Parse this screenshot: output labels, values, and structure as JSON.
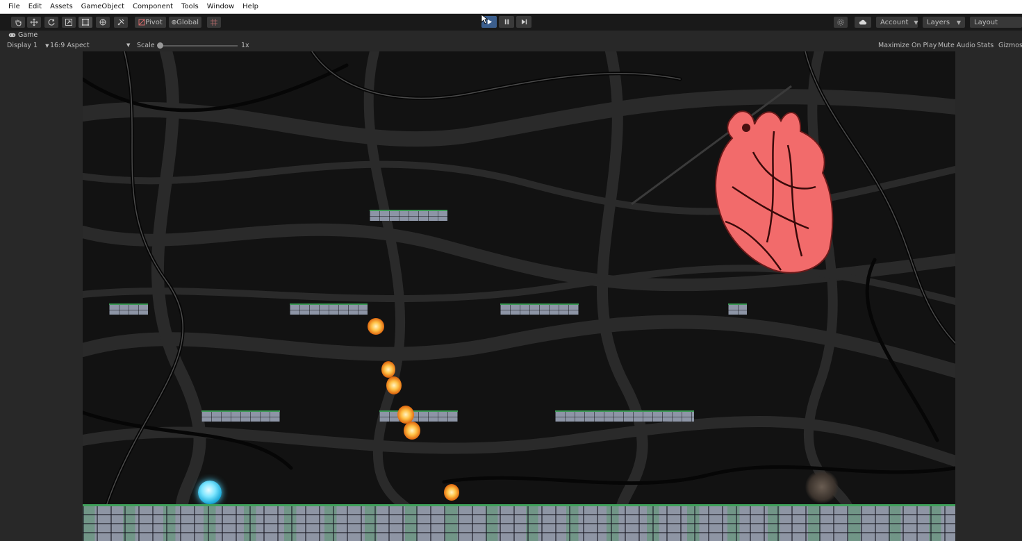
{
  "menu": [
    "File",
    "Edit",
    "Assets",
    "GameObject",
    "Component",
    "Tools",
    "Window",
    "Help"
  ],
  "toolbar": {
    "tools": [
      "hand-tool",
      "move-tool",
      "rotate-tool",
      "scale-tool",
      "rect-tool",
      "transform-tool",
      "custom-tool"
    ],
    "pivot_label": "Pivot",
    "global_label": "Global",
    "account_label": "Account",
    "layers_label": "Layers",
    "layout_label": "Layout"
  },
  "game_tab": {
    "label": "Game"
  },
  "game_bar": {
    "display": "Display 1",
    "aspect": "16:9 Aspect",
    "scale_label": "Scale",
    "scale_value": "1x",
    "maximize": "Maximize On Play",
    "mute": "Mute Audio",
    "stats": "Stats",
    "gizmos": "Gizmos"
  },
  "colors": {
    "play_button": "#3c5f8e",
    "heart": "#f26b6b",
    "platform_stone": "#8d95a6",
    "moss": "#3d9a56",
    "fireball": "#ffa53a",
    "orb": "#4fd8ff"
  }
}
